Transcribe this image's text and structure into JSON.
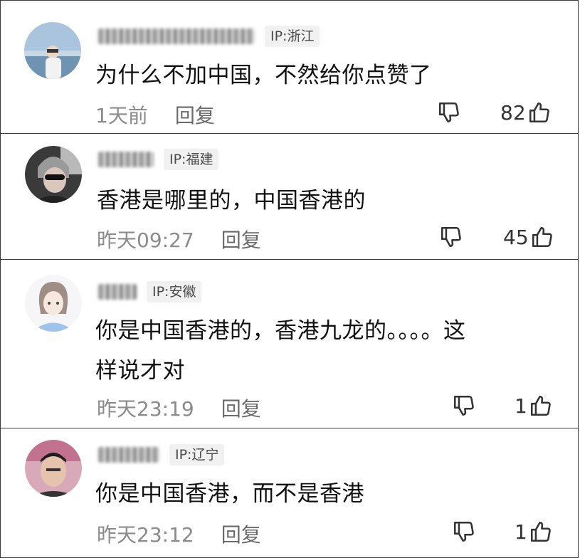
{
  "comments": [
    {
      "ip": "IP:浙江",
      "text_lines": [
        "为什么不加中国，不然给你点赞了"
      ],
      "time": "1天前",
      "reply": "回复",
      "likes": "82",
      "avatar": "seaside-person"
    },
    {
      "ip": "IP:福建",
      "text_lines": [
        "香港是哪里的，中国香港的"
      ],
      "time": "昨天09:27",
      "reply": "回复",
      "likes": "45",
      "avatar": "woman-sunglasses"
    },
    {
      "ip": "IP:安徽",
      "text_lines": [
        "你是中国香港的，香港九龙的。。。。这",
        "样说才对"
      ],
      "time": "昨天23:19",
      "reply": "回复",
      "likes": "1",
      "avatar": "anime-character"
    },
    {
      "ip": "IP:辽宁",
      "text_lines": [
        "你是中国香港，而不是香港"
      ],
      "time": "昨天23:12",
      "reply": "回复",
      "likes": "1",
      "avatar": "man-selfie"
    }
  ],
  "icons": {
    "dislike": "thumbs-down-icon",
    "like": "thumbs-up-icon"
  },
  "colors": {
    "meta": "#8b8b8b",
    "badge_bg": "#f1f1f1",
    "border": "#3a3a3a"
  }
}
